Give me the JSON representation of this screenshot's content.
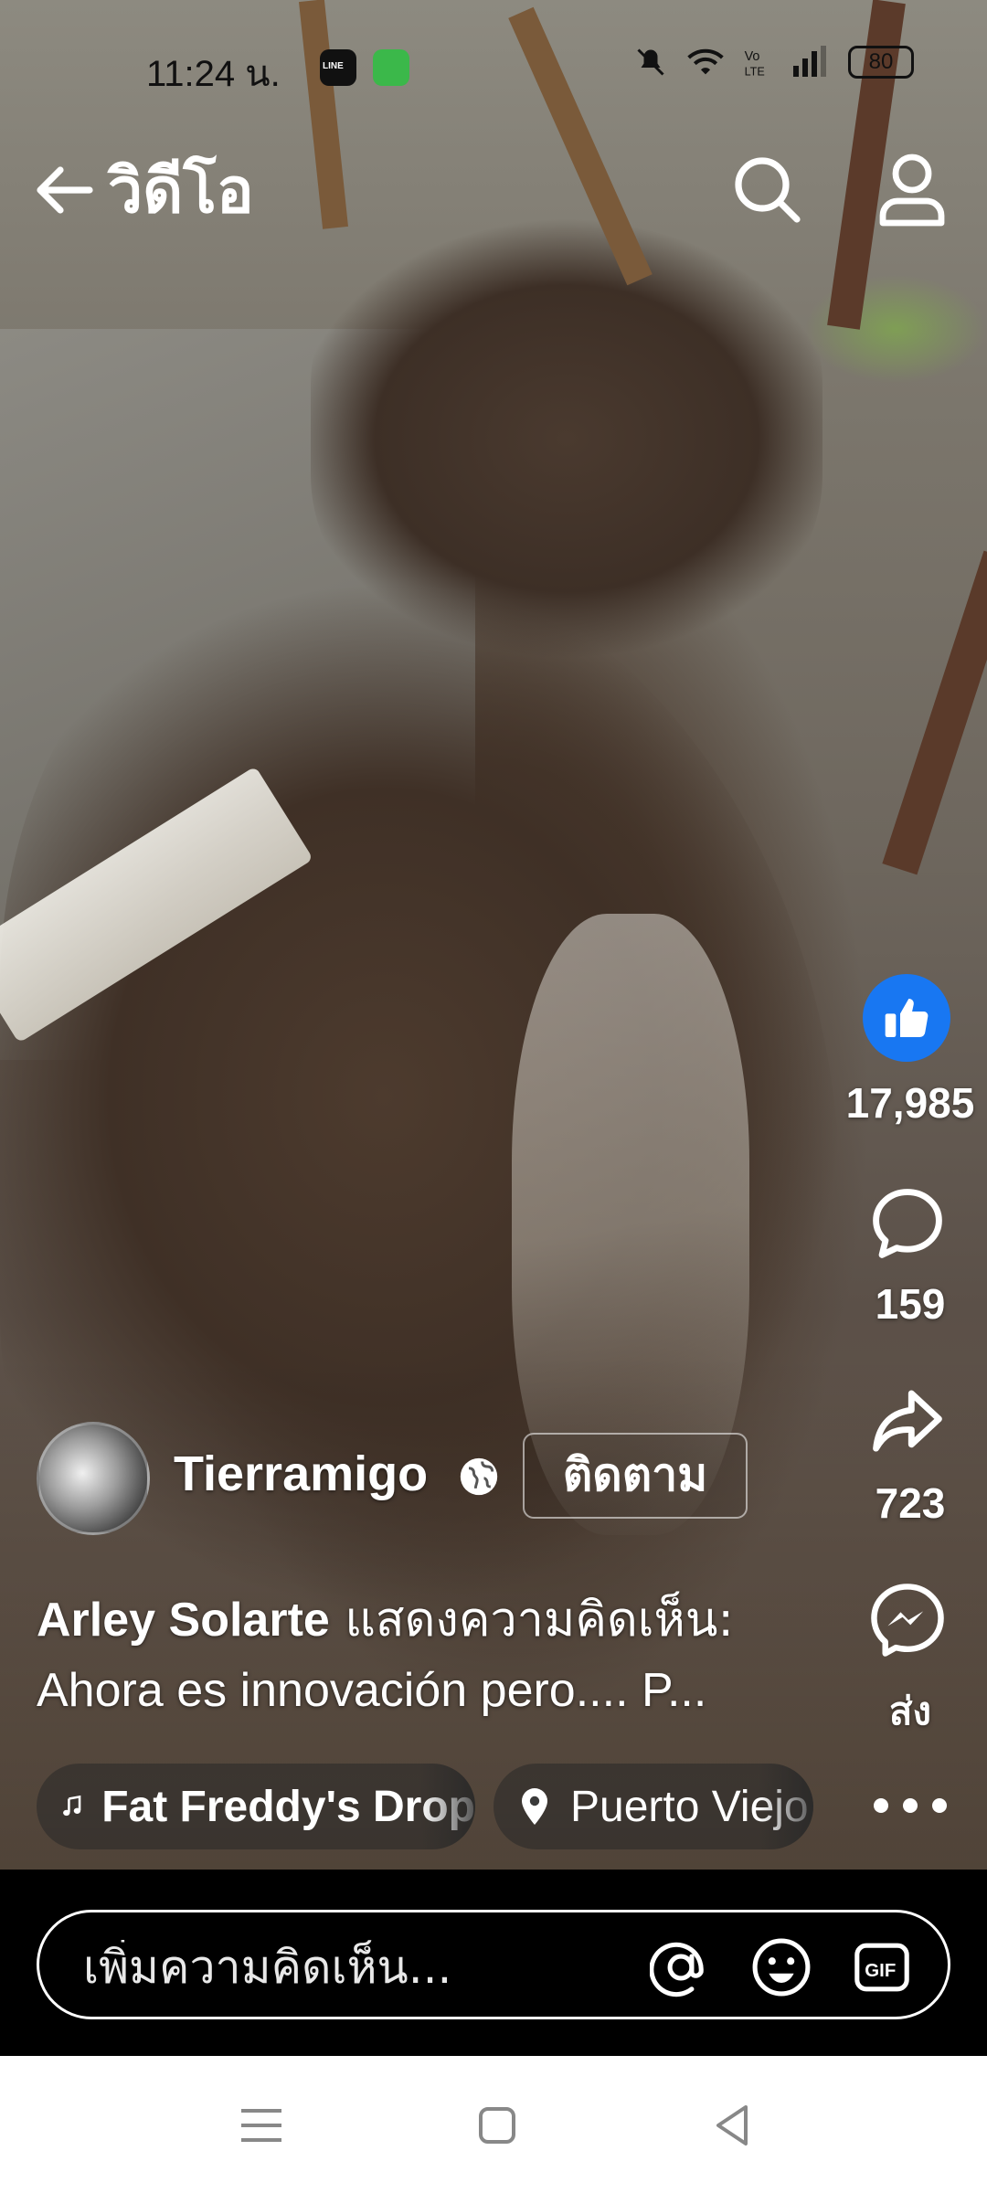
{
  "status_bar": {
    "time": "11:24 น.",
    "app_icons": [
      "line-icon",
      "messages-icon"
    ],
    "right_icons": [
      "mute-icon",
      "wifi-icon",
      "volte-icon",
      "signal-icon"
    ],
    "battery": "80"
  },
  "header": {
    "title": "วิดีโอ",
    "back_icon": "arrow-left-icon",
    "search_icon": "search-icon",
    "profile_icon": "person-icon"
  },
  "actions": {
    "like_count": "17,985",
    "comment_count": "159",
    "share_count": "723",
    "send_label": "ส่ง",
    "like_color": "#1877f2"
  },
  "post": {
    "channel_name": "Tierramigo",
    "audience_icon": "globe-icon",
    "follow_label": "ติดตาม",
    "comment_author": "Arley Solarte",
    "comment_verb": " แสดงความคิดเห็น:",
    "comment_text": "Ahora es innovación pero.... P...",
    "music": "Fat Freddy's Drop",
    "location": "Puerto Viejo"
  },
  "comment_bar": {
    "placeholder": "เพิ่มความคิดเห็น...",
    "icons": [
      "at-icon",
      "emoji-icon",
      "gif-icon"
    ]
  },
  "nav_bar": {
    "buttons": [
      "menu-icon",
      "home-icon",
      "back-icon"
    ]
  }
}
